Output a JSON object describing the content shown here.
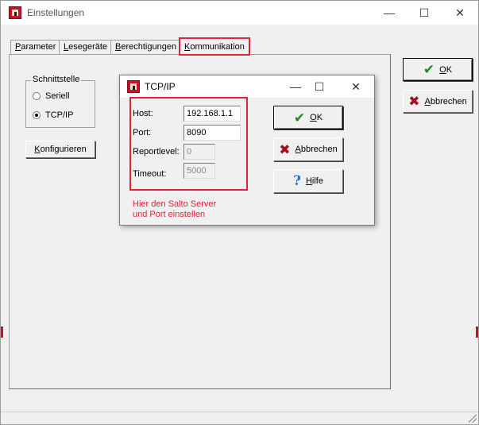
{
  "main_window": {
    "title": "Einstellungen",
    "controls": {
      "minimize": "—",
      "maximize": "☐",
      "close": "✕"
    },
    "tabs": [
      {
        "label": "Parameter",
        "underline": "P",
        "rest": "arameter"
      },
      {
        "label": "Lesegeräte",
        "underline": "L",
        "rest": "esegeräte"
      },
      {
        "label": "Berechtigungen",
        "underline": "B",
        "rest": "erechtigungen"
      },
      {
        "label": "Kommunikation",
        "underline": "K",
        "rest": "ommunikation",
        "active": true
      }
    ],
    "interface_group": {
      "label": "Schnittstelle",
      "options": [
        {
          "label": "Seriell",
          "checked": false
        },
        {
          "label": "TCP/IP",
          "checked": true
        }
      ]
    },
    "configure_button": {
      "underline": "K",
      "rest": "onfigurieren"
    },
    "ok_button": {
      "underline": "O",
      "rest": "K"
    },
    "cancel_button": {
      "underline": "A",
      "rest": "bbrechen"
    }
  },
  "dialog": {
    "title": "TCP/IP",
    "controls": {
      "minimize": "—",
      "maximize": "☐",
      "close": "✕"
    },
    "fields": {
      "host": {
        "label": "Host:",
        "value": "192.168.1.1"
      },
      "port": {
        "label": "Port:",
        "value": "8090"
      },
      "reportlevel": {
        "label": "Reportlevel:",
        "value": "0"
      },
      "timeout": {
        "label": "Timeout:",
        "value": "5000"
      }
    },
    "ok_button": {
      "underline": "O",
      "rest": "K"
    },
    "cancel_button": {
      "underline": "A",
      "rest": "bbrechen"
    },
    "help_button": {
      "underline": "H",
      "rest": "ilfe"
    },
    "note_line1": "Hier den Salto Server",
    "note_line2": "und Port einstellen"
  },
  "colors": {
    "highlight": "#e32233",
    "check_green": "#1d8a2a",
    "cross_red": "#a1101c",
    "help_blue": "#1d6fd8"
  },
  "icons": {
    "app": "salto-app-icon",
    "ok": "check-icon",
    "cancel": "cross-icon",
    "help": "help-icon"
  }
}
